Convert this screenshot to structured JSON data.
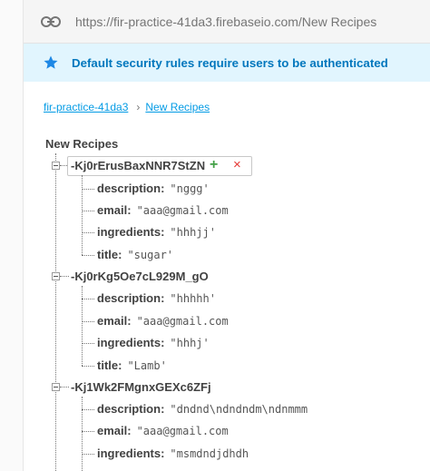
{
  "url": "https://fir-practice-41da3.firebaseio.com/New Recipes",
  "banner": {
    "message": "Default security rules require users to be authenticated"
  },
  "breadcrumb": {
    "root": "fir-practice-41da3",
    "separator": "›",
    "current": "New Recipes"
  },
  "tree": {
    "root": "New Recipes",
    "actions": {
      "add": "+",
      "remove": "×"
    },
    "children": [
      {
        "key": "-Kj0rErusBaxNNR7StZN",
        "fields": [
          {
            "name": "description:",
            "value": "\"nggg'"
          },
          {
            "name": "email:",
            "value": "\"aaa@gmail.com"
          },
          {
            "name": "ingredients:",
            "value": "\"hhhjj'"
          },
          {
            "name": "title:",
            "value": "\"sugar'"
          }
        ]
      },
      {
        "key": "-Kj0rKg5Oe7cL929M_gO",
        "fields": [
          {
            "name": "description:",
            "value": "\"hhhhh'"
          },
          {
            "name": "email:",
            "value": "\"aaa@gmail.com"
          },
          {
            "name": "ingredients:",
            "value": "\"hhhj'"
          },
          {
            "name": "title:",
            "value": "\"Lamb'"
          }
        ]
      },
      {
        "key": "-Kj1Wk2FMgnxGEXc6ZFj",
        "fields": [
          {
            "name": "description:",
            "value": "\"dndnd\\ndndndm\\ndnmmm"
          },
          {
            "name": "email:",
            "value": "\"aaa@gmail.com"
          },
          {
            "name": "ingredients:",
            "value": "\"msmdndjdhdh"
          }
        ]
      }
    ]
  },
  "colors": {
    "banner_bg": "#e1f5fe",
    "banner_text": "#0277bd",
    "link": "#039be5",
    "add": "#43a047",
    "remove": "#e53935"
  }
}
